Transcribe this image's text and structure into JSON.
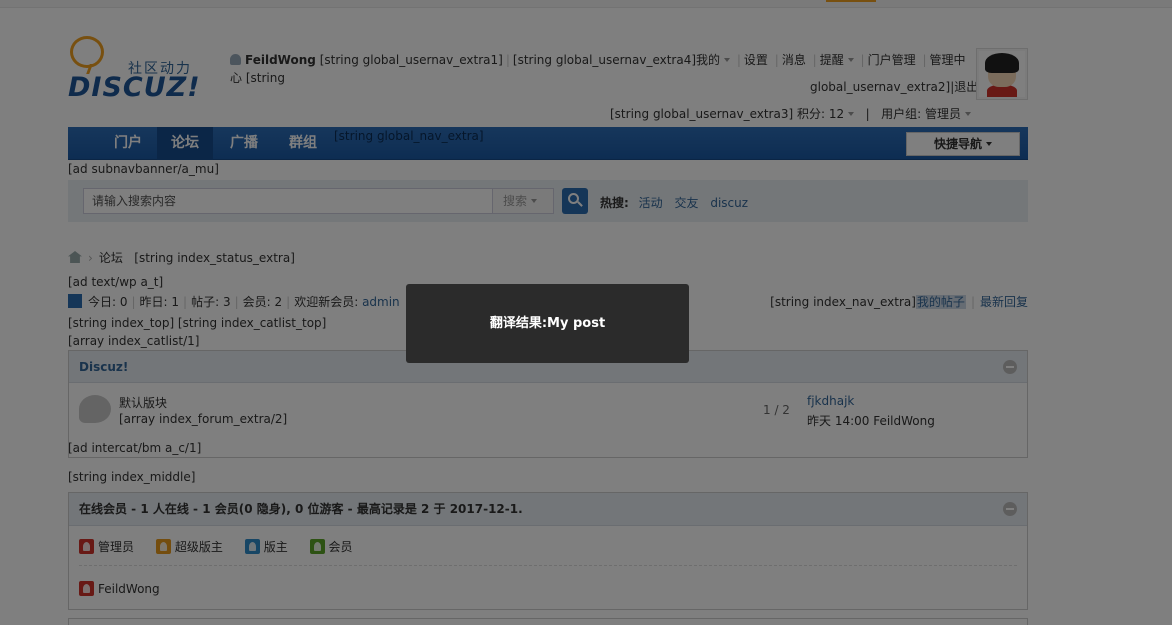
{
  "logo": {
    "cn_text": "社区动力",
    "en_text": "DISCUZ!"
  },
  "usernav": {
    "username": "FeildWong",
    "extra1": "[string global_usernav_extra1]",
    "extra4": "[string global_usernav_extra4]我的",
    "settings": "设置",
    "messages": "消息",
    "reminders": "提醒",
    "portal_manage": "门户管理",
    "admin_center": "管理中心",
    "extra2_prefix": "[string",
    "extra2_rest": "global_usernav_extra2]",
    "logout": "退出",
    "extra3": "[string global_usernav_extra3]",
    "credits": "积分: 12",
    "usergroup": "用户组: 管理员"
  },
  "nav": {
    "items": [
      "门户",
      "论坛",
      "广播",
      "群组"
    ],
    "extra": "[string global_nav_extra]",
    "quick_nav": "快捷导航"
  },
  "ad_subnav": "[ad subnavbanner/a_mu]",
  "search": {
    "placeholder": "请输入搜索内容",
    "type": "搜索",
    "hot_label": "热搜:",
    "hot_terms": [
      "活动",
      "交友",
      "discuz"
    ]
  },
  "breadcrumb": {
    "current": "论坛",
    "extra": "[string index_status_extra]"
  },
  "ad_text": "[ad text/wp a_t]",
  "stats": {
    "today": "今日: 0",
    "yesterday": "昨日: 1",
    "posts": "帖子: 3",
    "members": "会员: 2",
    "welcome": "欢迎新会员:",
    "new_member": "admin",
    "nav_extra": "[string index_nav_extra]",
    "my_posts": "我的帖子",
    "latest_reply": "最新回复"
  },
  "index_top": "[string index_top] [string index_catlist_top]",
  "catlist": "[array index_catlist/1]",
  "forum_section": {
    "title": "Discuz!",
    "forum_name": "默认版块",
    "forum_extra": "[array index_forum_extra/2]",
    "counts": "1 / 2",
    "last_post_title": "fjkdhajk",
    "last_post_meta": "昨天 14:00 FeildWong"
  },
  "ad_intercat": "[ad intercat/bm a_c/1]",
  "index_middle": "[string index_middle]",
  "online": {
    "header": "在线会员 - 1 人在线 - 1 会员(0 隐身), 0 位游客 - 最高记录是 2 于 2017-12-1.",
    "legend": [
      "管理员",
      "超级版主",
      "版主",
      "会员"
    ],
    "members": [
      "FeildWong"
    ]
  },
  "toast": {
    "message": "翻译结果:My post"
  },
  "colors": {
    "nav_blue": "#1b5aa5",
    "link": "#336699",
    "overlay": "rgba(0,0,0,0.5)",
    "toast_bg": "#2b2b2b"
  }
}
